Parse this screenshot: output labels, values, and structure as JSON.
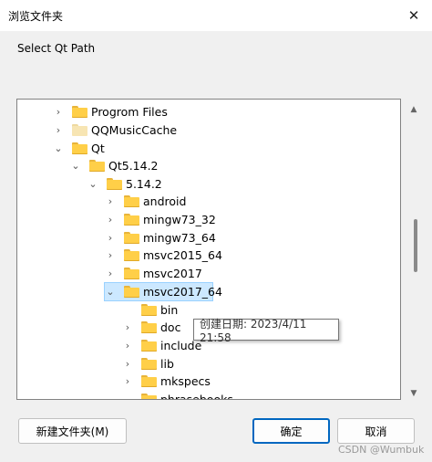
{
  "window": {
    "title": "浏览文件夹",
    "close_glyph": "✕"
  },
  "dialog": {
    "prompt": "Select Qt Path"
  },
  "tree": {
    "items": [
      {
        "label": "Progrom Files",
        "chevron": "›"
      },
      {
        "label": "QQMusicCache",
        "chevron": "›"
      },
      {
        "label": "Qt",
        "chevron": "⌄"
      },
      {
        "label": "Qt5.14.2",
        "chevron": "⌄"
      },
      {
        "label": "5.14.2",
        "chevron": "⌄"
      },
      {
        "label": "android",
        "chevron": "›"
      },
      {
        "label": "mingw73_32",
        "chevron": "›"
      },
      {
        "label": "mingw73_64",
        "chevron": "›"
      },
      {
        "label": "msvc2015_64",
        "chevron": "›"
      },
      {
        "label": "msvc2017",
        "chevron": "›"
      },
      {
        "label": "msvc2017_64",
        "chevron": "⌄"
      },
      {
        "label": "bin",
        "chevron": ""
      },
      {
        "label": "doc",
        "chevron": "›"
      },
      {
        "label": "include",
        "chevron": "›"
      },
      {
        "label": "lib",
        "chevron": "›"
      },
      {
        "label": "mkspecs",
        "chevron": "›"
      },
      {
        "label": "phrasebooks",
        "chevron": ""
      }
    ],
    "selected": "msvc2017_64"
  },
  "tooltip": {
    "text": "创建日期: 2023/4/11 21:58"
  },
  "scrollbar": {
    "up_glyph": "▲",
    "down_glyph": "▼"
  },
  "buttons": {
    "new_folder": "新建文件夹(M)",
    "ok": "确定",
    "cancel": "取消"
  },
  "watermark": "CSDN @Wumbuk"
}
